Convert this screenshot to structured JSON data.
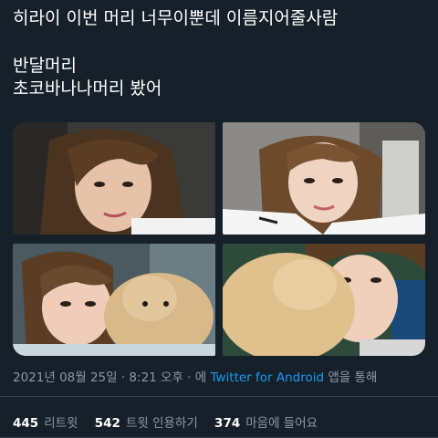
{
  "tweet": {
    "line1": "히라이 이번 머리 너무이뿐데 이름지어줄사람",
    "line2": "반달머리",
    "line3": "초코바나나머리 봤어"
  },
  "media": [
    {
      "alt_icon": "photo"
    },
    {
      "alt_icon": "photo"
    },
    {
      "alt_icon": "photo"
    },
    {
      "alt_icon": "photo"
    }
  ],
  "meta": {
    "date": "2021년 08월 25일 · 8:21 오후 · 에 ",
    "source": "Twitter for Android",
    "suffix": " 앱을 통해"
  },
  "stats": {
    "retweets_count": "445",
    "retweets_label": "리트윗",
    "quotes_count": "542",
    "quotes_label": "트윗 인용하기",
    "likes_count": "374",
    "likes_label": "마음에 들어요"
  },
  "colors": {
    "background": "#15202b",
    "text": "#ffffff",
    "muted": "#8b98a5",
    "link": "#1d9bf0",
    "border": "#38444d"
  }
}
